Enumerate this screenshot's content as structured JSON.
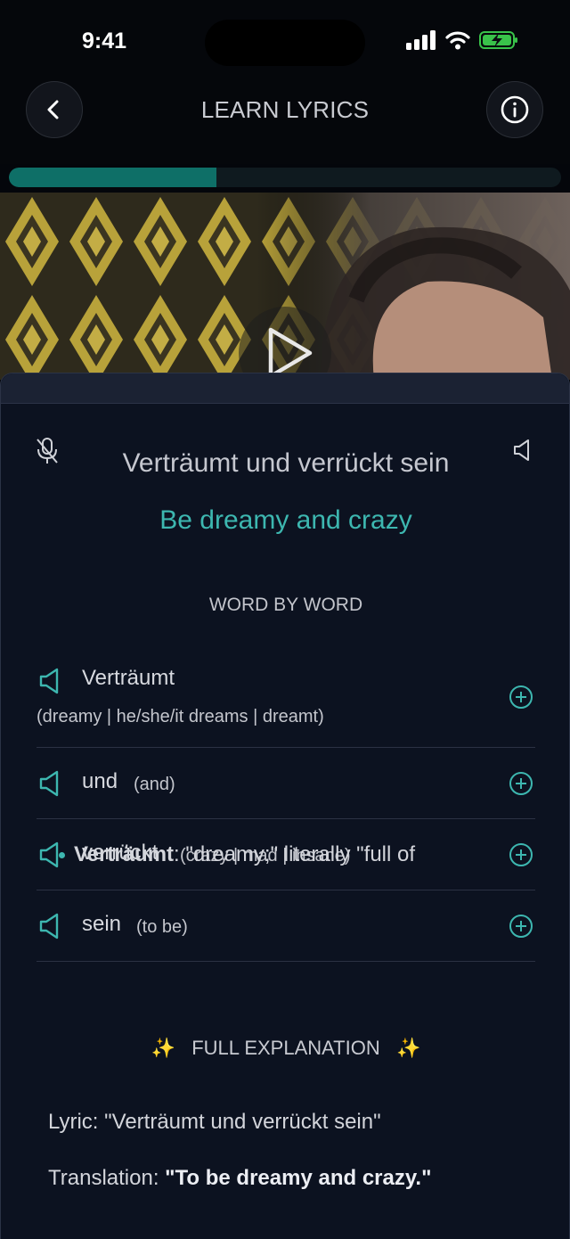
{
  "status": {
    "time": "9:41"
  },
  "header": {
    "title": "LEARN LYRICS",
    "back_icon": "chevron-left-icon",
    "info_icon": "info-icon"
  },
  "progress": {
    "fraction": 0.375
  },
  "lyric": {
    "original": "Verträumt und verrückt sein",
    "translation": "Be dreamy and crazy"
  },
  "word_by_word": {
    "title": "WORD BY WORD",
    "items": [
      {
        "word": "Verträumt",
        "gloss": "(dreamy | he/she/it dreams | dreamt)"
      },
      {
        "word": "und",
        "gloss": "(and)"
      },
      {
        "word": "verrückt",
        "gloss": "(crazy | mad | insane)"
      },
      {
        "word": "sein",
        "gloss": "(to be)"
      }
    ]
  },
  "explanation": {
    "title": "FULL EXPLANATION",
    "sparkle": "✨",
    "lyric_label": "Lyric:",
    "lyric_value": "\"Verträumt und verrückt sein\"",
    "translation_label": "Translation:",
    "translation_value": "\"To be dreamy and crazy.\"",
    "bullet_term": "Verträumt",
    "bullet_text": ": \"dreamy;\" literally \"full of"
  },
  "colors": {
    "accent": "#3db7b0",
    "progress": "#0e6f67",
    "sheet_bg": "#0c1220"
  }
}
